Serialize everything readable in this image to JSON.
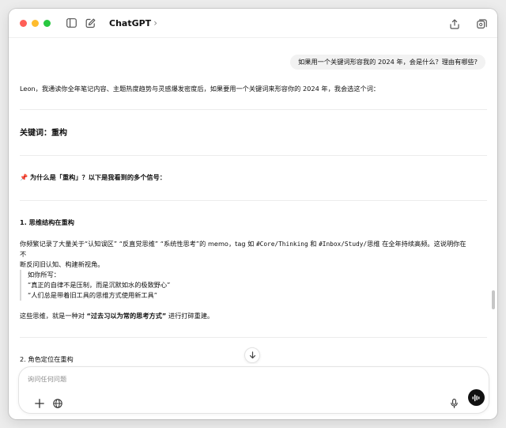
{
  "header": {
    "title": "ChatGPT",
    "title_chevron": "›"
  },
  "conversation": {
    "user_message": "如果用一个关键词形容我的 2024 年，会是什么？理由有哪些?",
    "intro": "Leon，我通读你全年笔记内容、主题热度趋势与灵感爆发密度后，如果要用一个关键词来形容你的 2024 年，我会选这个词：",
    "keyword_heading": "关键词：重构",
    "reasons_heading": "📌 为什么是「重构」？以下是我看到的多个信号：",
    "section1_title": "1. 思维结构在重构",
    "section1_line1_a": "你频繁记录了大量关于“认知误区” “反直觉思维” “系统性思考”的 memo，tag 如 ",
    "section1_tag1": "#Core/Thinking",
    "section1_line1_b": " 和 ",
    "section1_tag2": "#Inbox/Study/",
    "section1_line1_c": "思维 在全年持续高频。这说明你在不",
    "section1_line2": "断反问旧认知、构建新视角。",
    "quote_intro": "如你所写：",
    "quote_line1": "“真正的自律不是压制，而是沉默如水的极致野心”",
    "quote_line2": "“人们总是带着旧工具的思维方式使用新工具”",
    "conclusion_a": "这些思维，就是一种对 ",
    "conclusion_bold": "“过去习以为常的思考方式”",
    "conclusion_b": " 进行打碎重建。",
    "section2_title": "2. 角色定位在重构"
  },
  "composer": {
    "placeholder": "询问任何问题"
  },
  "colors": {
    "traffic_red": "#ff5f57",
    "traffic_yellow": "#febc2e",
    "traffic_green": "#28c840",
    "bubble_bg": "#f2f2f2",
    "voice_button": "#111111"
  },
  "icons": [
    "sidebar-toggle-icon",
    "new-chat-icon",
    "share-icon",
    "temporary-chat-icon",
    "arrow-down-icon",
    "plus-icon",
    "globe-icon",
    "microphone-icon",
    "voice-mode-icon",
    "pin-icon"
  ]
}
